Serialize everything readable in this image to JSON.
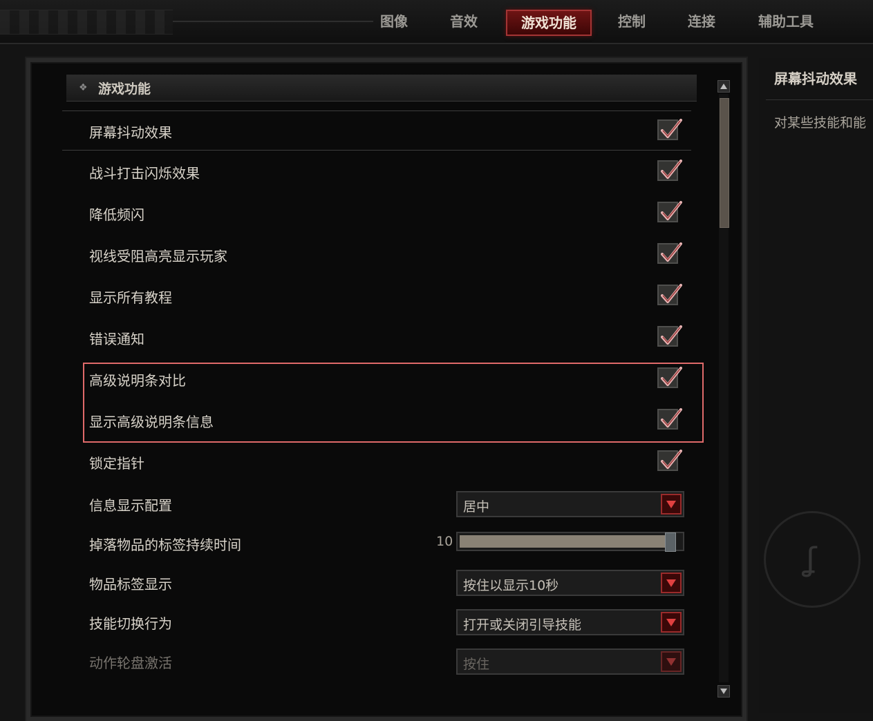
{
  "tabs": [
    {
      "label": "图像",
      "active": false
    },
    {
      "label": "音效",
      "active": false
    },
    {
      "label": "游戏功能",
      "active": true
    },
    {
      "label": "控制",
      "active": false
    },
    {
      "label": "连接",
      "active": false
    },
    {
      "label": "辅助工具",
      "active": false
    }
  ],
  "section": {
    "title": "游戏功能",
    "icon": "diamond-icon"
  },
  "settings": [
    {
      "label": "屏幕抖动效果",
      "type": "checkbox",
      "checked": true
    },
    {
      "label": "战斗打击闪烁效果",
      "type": "checkbox",
      "checked": true
    },
    {
      "label": "降低频闪",
      "type": "checkbox",
      "checked": true
    },
    {
      "label": "视线受阻高亮显示玩家",
      "type": "checkbox",
      "checked": true
    },
    {
      "label": "显示所有教程",
      "type": "checkbox",
      "checked": true
    },
    {
      "label": "错误通知",
      "type": "checkbox",
      "checked": true
    },
    {
      "label": "高级说明条对比",
      "type": "checkbox",
      "checked": true
    },
    {
      "label": "显示高级说明条信息",
      "type": "checkbox",
      "checked": true
    },
    {
      "label": "锁定指针",
      "type": "checkbox",
      "checked": true
    },
    {
      "label": "信息显示配置",
      "type": "dropdown",
      "value": "居中"
    },
    {
      "label": "掉落物品的标签持续时间",
      "type": "slider",
      "value": "10",
      "fill_fraction": 0.97
    },
    {
      "label": "物品标签显示",
      "type": "dropdown",
      "value": "按住以显示10秒"
    },
    {
      "label": "技能切换行为",
      "type": "dropdown",
      "value": "打开或关闭引导技能"
    },
    {
      "label": "动作轮盘激活",
      "type": "dropdown",
      "value": "按住",
      "disabled": true
    }
  ],
  "info": {
    "title": "屏幕抖动效果",
    "description": "对某些技能和能"
  },
  "colors": {
    "accent": "#a43434",
    "checkmark": "#e8b4b4",
    "highlight_box": "#e06a6a"
  }
}
